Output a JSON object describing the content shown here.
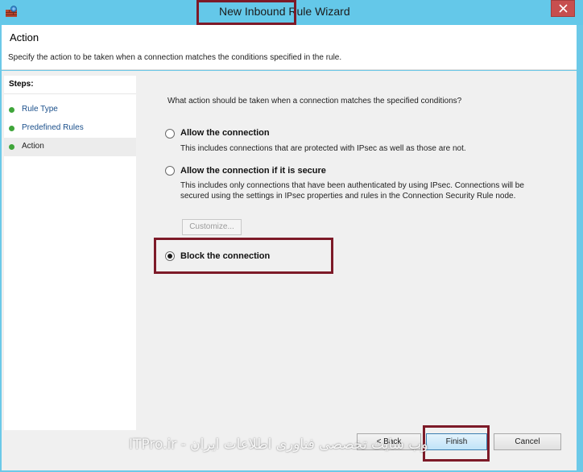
{
  "window": {
    "title": "New Inbound Rule Wizard",
    "app_icon": "firewall-icon",
    "close_icon": "close-icon",
    "close_color": "#c74f4f"
  },
  "header": {
    "title": "Action",
    "description": "Specify the action to be taken when a connection matches the conditions specified in the rule."
  },
  "steps": {
    "title": "Steps:",
    "items": [
      {
        "label": "Rule Type",
        "active": false
      },
      {
        "label": "Predefined Rules",
        "active": false
      },
      {
        "label": "Action",
        "active": true
      }
    ]
  },
  "content": {
    "question": "What action should be taken when a connection matches the specified conditions?",
    "options": [
      {
        "label": "Allow the connection",
        "description": "This includes connections that are protected with IPsec as well as those are not.",
        "checked": false
      },
      {
        "label": "Allow the connection if it is secure",
        "description": "This includes only connections that have been authenticated by using IPsec.  Connections will be secured using the settings in IPsec properties and rules in the Connection Security Rule node.",
        "checked": false
      },
      {
        "label": "Block the connection",
        "description": "",
        "checked": true
      }
    ],
    "customize_label": "Customize..."
  },
  "footer": {
    "back_label": "< Back",
    "finish_label": "Finish",
    "cancel_label": "Cancel"
  },
  "watermark": "وب سایت تخصصی فناوری اطلاعات ایران - ITPro.ir",
  "colors": {
    "titlebar": "#64c8e9",
    "highlight": "#7d1a28",
    "step_dot": "#3fa53a"
  }
}
